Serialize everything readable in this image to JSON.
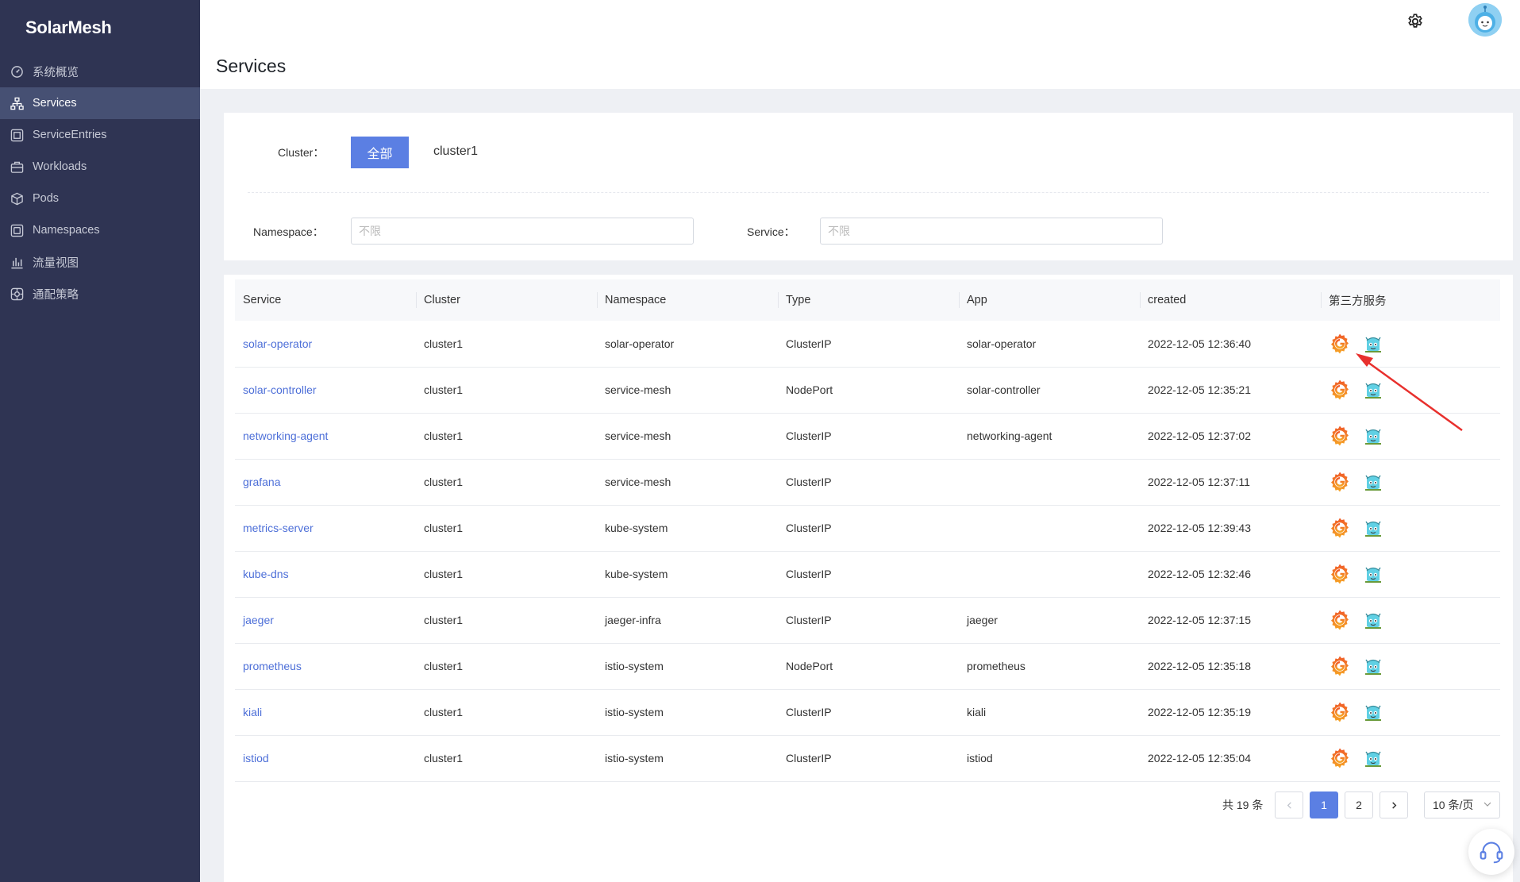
{
  "app": {
    "name": "SolarMesh"
  },
  "sidebar": {
    "items": [
      {
        "label": "系统概览",
        "icon": "dashboard-icon"
      },
      {
        "label": "Services",
        "icon": "sitemap-icon",
        "active": true
      },
      {
        "label": "ServiceEntries",
        "icon": "entry-icon"
      },
      {
        "label": "Workloads",
        "icon": "briefcase-icon"
      },
      {
        "label": "Pods",
        "icon": "cube-icon"
      },
      {
        "label": "Namespaces",
        "icon": "namespace-icon"
      },
      {
        "label": "流量视图",
        "icon": "bar-chart-icon"
      },
      {
        "label": "通配策略",
        "icon": "policy-icon"
      }
    ]
  },
  "page": {
    "title": "Services"
  },
  "filters": {
    "cluster_label": "Cluster：",
    "cluster_all": "全部",
    "cluster_option": "cluster1",
    "namespace_label": "Namespace：",
    "namespace_placeholder": "不限",
    "service_label": "Service：",
    "service_placeholder": "不限"
  },
  "table": {
    "headers": [
      "Service",
      "Cluster",
      "Namespace",
      "Type",
      "App",
      "created",
      "第三方服务"
    ],
    "rows": [
      {
        "service": "solar-operator",
        "cluster": "cluster1",
        "namespace": "solar-operator",
        "type": "ClusterIP",
        "app": "solar-operator",
        "created": "2022-12-05 12:36:40"
      },
      {
        "service": "solar-controller",
        "cluster": "cluster1",
        "namespace": "service-mesh",
        "type": "NodePort",
        "app": "solar-controller",
        "created": "2022-12-05 12:35:21"
      },
      {
        "service": "networking-agent",
        "cluster": "cluster1",
        "namespace": "service-mesh",
        "type": "ClusterIP",
        "app": "networking-agent",
        "created": "2022-12-05 12:37:02"
      },
      {
        "service": "grafana",
        "cluster": "cluster1",
        "namespace": "service-mesh",
        "type": "ClusterIP",
        "app": "",
        "created": "2022-12-05 12:37:11"
      },
      {
        "service": "metrics-server",
        "cluster": "cluster1",
        "namespace": "kube-system",
        "type": "ClusterIP",
        "app": "",
        "created": "2022-12-05 12:39:43"
      },
      {
        "service": "kube-dns",
        "cluster": "cluster1",
        "namespace": "kube-system",
        "type": "ClusterIP",
        "app": "",
        "created": "2022-12-05 12:32:46"
      },
      {
        "service": "jaeger",
        "cluster": "cluster1",
        "namespace": "jaeger-infra",
        "type": "ClusterIP",
        "app": "jaeger",
        "created": "2022-12-05 12:37:15"
      },
      {
        "service": "prometheus",
        "cluster": "cluster1",
        "namespace": "istio-system",
        "type": "NodePort",
        "app": "prometheus",
        "created": "2022-12-05 12:35:18"
      },
      {
        "service": "kiali",
        "cluster": "cluster1",
        "namespace": "istio-system",
        "type": "ClusterIP",
        "app": "kiali",
        "created": "2022-12-05 12:35:19"
      },
      {
        "service": "istiod",
        "cluster": "cluster1",
        "namespace": "istio-system",
        "type": "ClusterIP",
        "app": "istiod",
        "created": "2022-12-05 12:35:04"
      }
    ],
    "third_party_icons": [
      "grafana-icon",
      "jaeger-icon"
    ]
  },
  "pagination": {
    "total_text": "共 19 条",
    "pages": [
      "1",
      "2"
    ],
    "current": "1",
    "page_size": "10 条/页"
  },
  "colors": {
    "sidebar_bg": "#2f3453",
    "accent": "#5b7fe3",
    "link": "#4d6fd8",
    "annotation_arrow": "#e8302d"
  }
}
